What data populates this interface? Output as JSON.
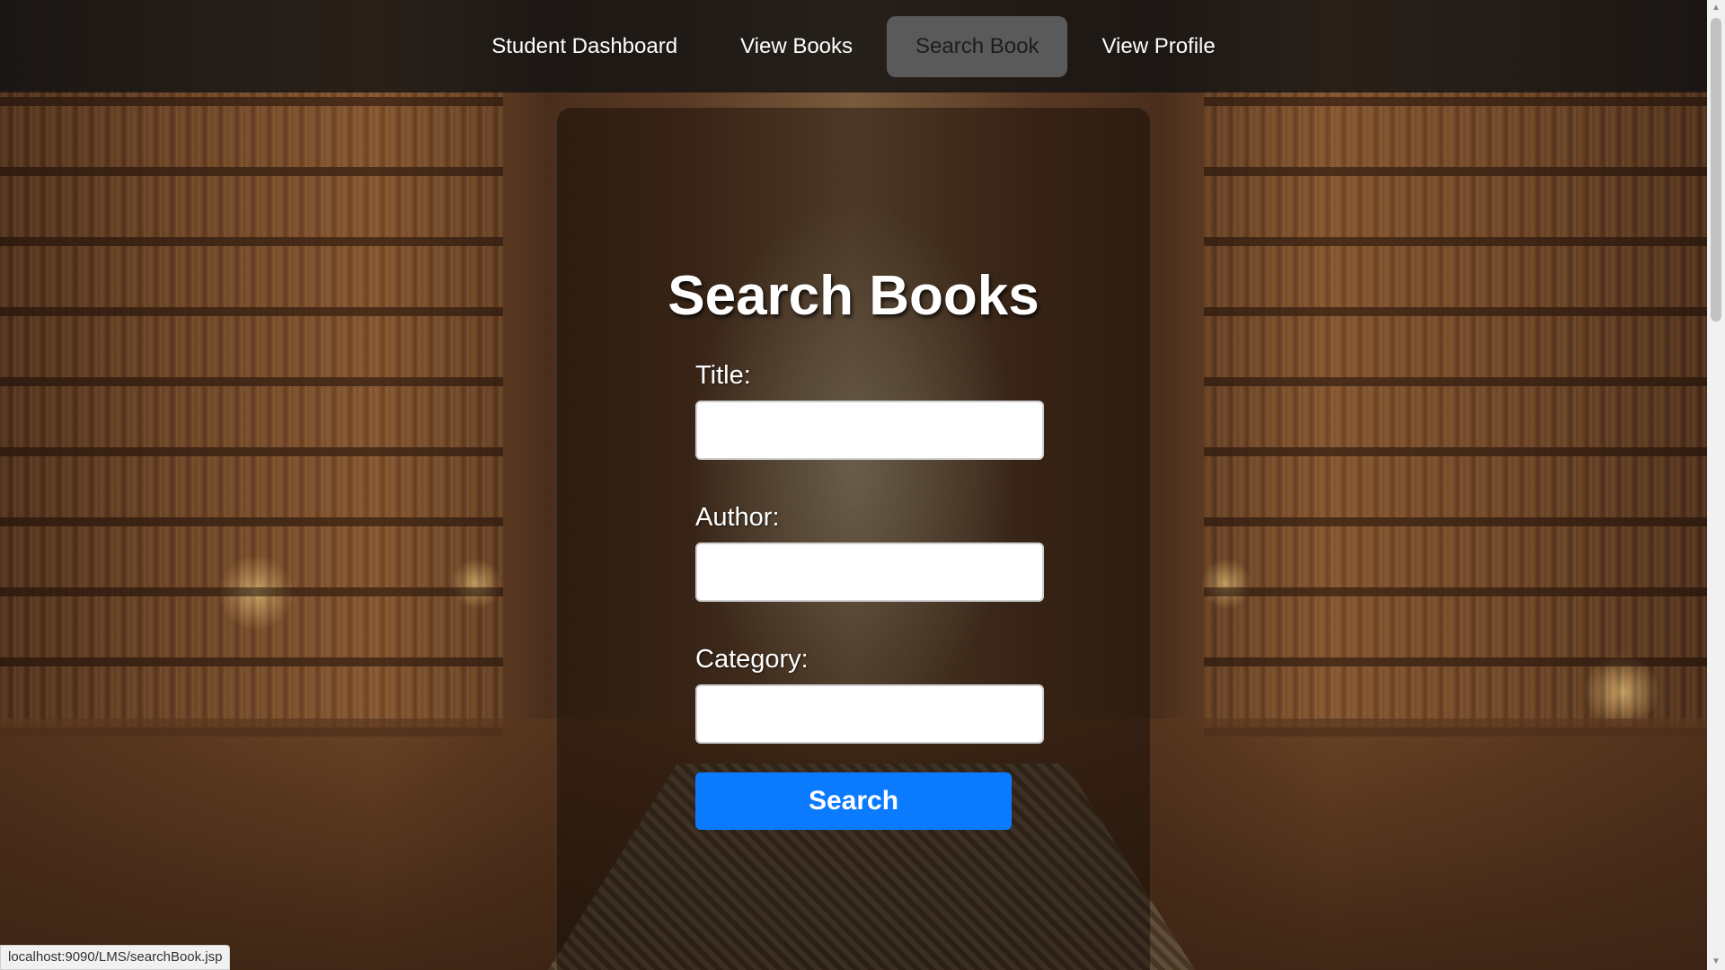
{
  "nav": {
    "items": [
      {
        "label": "Student Dashboard",
        "active": false
      },
      {
        "label": "View Books",
        "active": false
      },
      {
        "label": "Search Book",
        "active": true
      },
      {
        "label": "View Profile",
        "active": false
      }
    ]
  },
  "main": {
    "title": "Search Books",
    "fields": [
      {
        "label": "Title:",
        "value": "",
        "placeholder": ""
      },
      {
        "label": "Author:",
        "value": "",
        "placeholder": ""
      },
      {
        "label": "Category:",
        "value": "",
        "placeholder": ""
      }
    ],
    "search_label": "Search"
  },
  "status_bar": {
    "url": "localhost:9090/LMS/searchBook.jsp"
  },
  "colors": {
    "accent": "#0a7aff",
    "nav_background": "#141414",
    "nav_active": "#5a5a5a"
  },
  "icons": {
    "scroll_up": "chevron-up-icon",
    "scroll_down": "chevron-down-icon"
  }
}
